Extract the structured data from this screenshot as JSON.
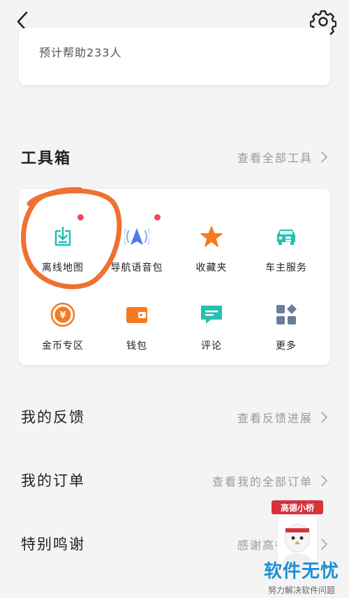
{
  "header": {
    "back_icon": "chevron-left-icon",
    "settings_icon": "gear-icon"
  },
  "top_card": {
    "help_text": "预计帮助233人"
  },
  "toolbox": {
    "title": "工具箱",
    "view_all": "查看全部工具",
    "tools": [
      {
        "label": "离线地图",
        "icon": "download-tray-icon",
        "badge": true,
        "color": "#25c0b0"
      },
      {
        "label": "导航语音包",
        "icon": "navigation-voice-icon",
        "badge": true,
        "color": "#4a7bea"
      },
      {
        "label": "收藏夹",
        "icon": "star-icon",
        "badge": false,
        "color": "#f47b20"
      },
      {
        "label": "车主服务",
        "icon": "car-service-icon",
        "badge": false,
        "color": "#25c0b0"
      },
      {
        "label": "金币专区",
        "icon": "gold-coin-icon",
        "badge": false,
        "color": "#f47b20"
      },
      {
        "label": "钱包",
        "icon": "wallet-icon",
        "badge": false,
        "color": "#f47b20"
      },
      {
        "label": "评论",
        "icon": "comment-icon",
        "badge": false,
        "color": "#25c0b0"
      },
      {
        "label": "更多",
        "icon": "more-grid-icon",
        "badge": false,
        "color": "#6b7d99"
      }
    ]
  },
  "rows": [
    {
      "title": "我的反馈",
      "link": "查看反馈进展"
    },
    {
      "title": "我的订单",
      "link": "查看我的全部订单"
    },
    {
      "title": "特别鸣谢",
      "link": "感谢高德热心"
    }
  ],
  "mascot": {
    "sign": "高德小桥"
  },
  "watermark": {
    "title": "软件无忧",
    "subtitle": "努力解决软件问题"
  },
  "colors": {
    "accent_orange": "#f47b20",
    "accent_teal": "#25c0b0",
    "accent_blue": "#4a7bea",
    "badge_red": "#f4465a",
    "annotation": "#f07030"
  }
}
